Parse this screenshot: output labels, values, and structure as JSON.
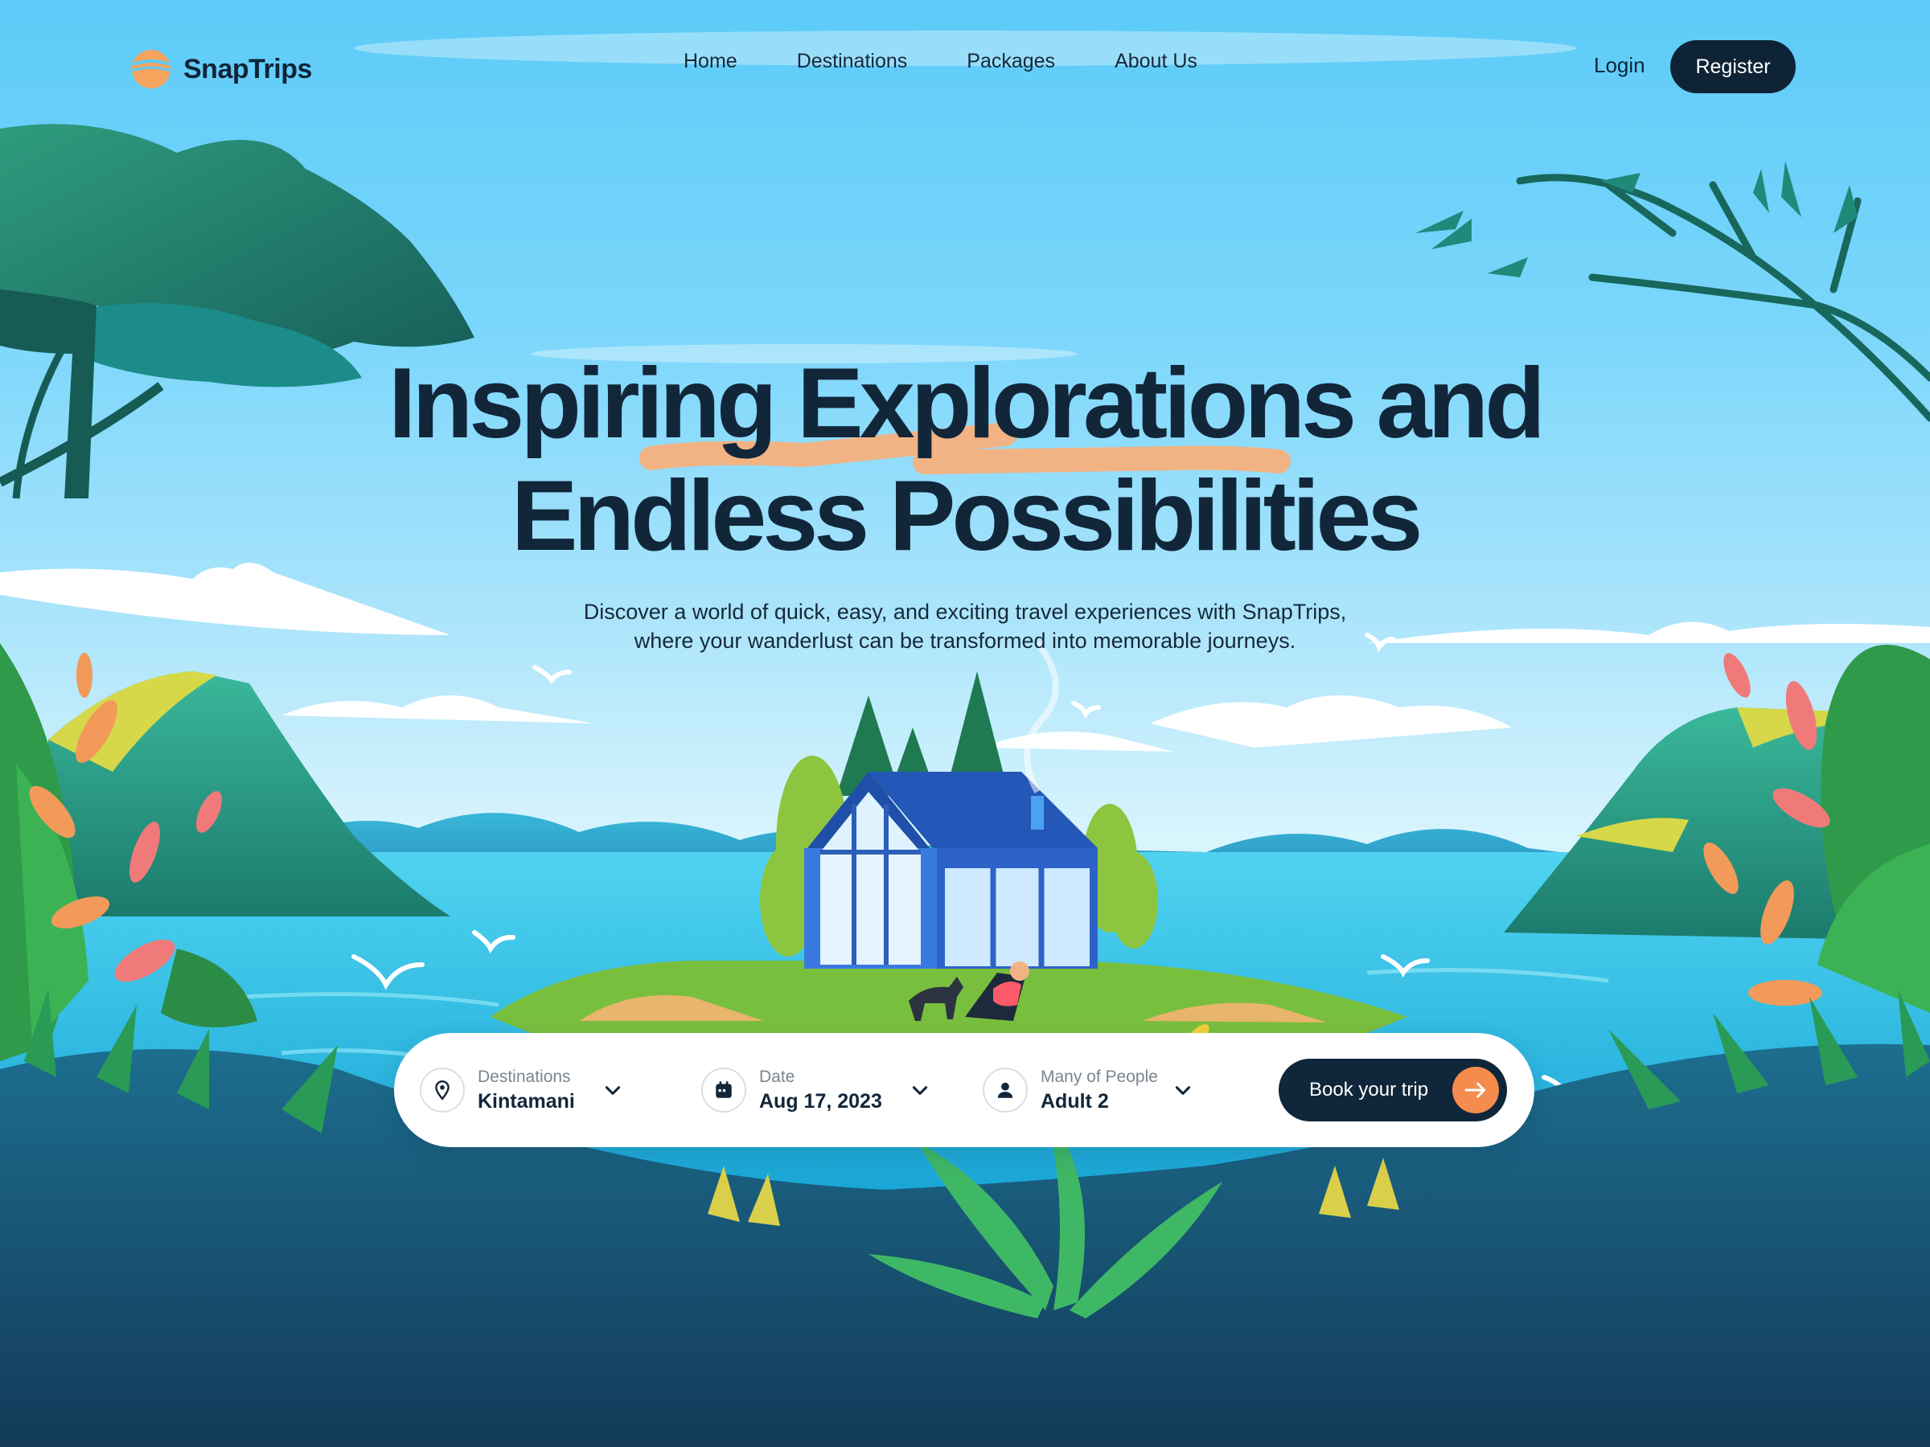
{
  "brand": {
    "name": "SnapTrips"
  },
  "nav": {
    "items": [
      "Home",
      "Destinations",
      "Packages",
      "About Us"
    ],
    "login": "Login",
    "register": "Register"
  },
  "hero": {
    "title_line1": "Inspiring Explorations and",
    "title_line2": "Endless Possibilities",
    "subtitle_line1": "Discover a world of quick, easy, and exciting travel experiences with SnapTrips,",
    "subtitle_line2": "where your wanderlust can be transformed into memorable journeys."
  },
  "booking": {
    "destination": {
      "label": "Destinations",
      "value": "Kintamani",
      "icon": "location-pin-icon"
    },
    "date": {
      "label": "Date",
      "value": "Aug 17, 2023",
      "icon": "calendar-icon"
    },
    "people": {
      "label": "Many of People",
      "value": "Adult 2",
      "icon": "user-icon"
    },
    "cta": {
      "label": "Book your trip",
      "icon": "arrow-right-icon"
    }
  },
  "colors": {
    "navy": "#0f2336",
    "accent_orange": "#f58b4c",
    "highlight_peach": "#f2b384",
    "sky": "#5ccbf8"
  }
}
